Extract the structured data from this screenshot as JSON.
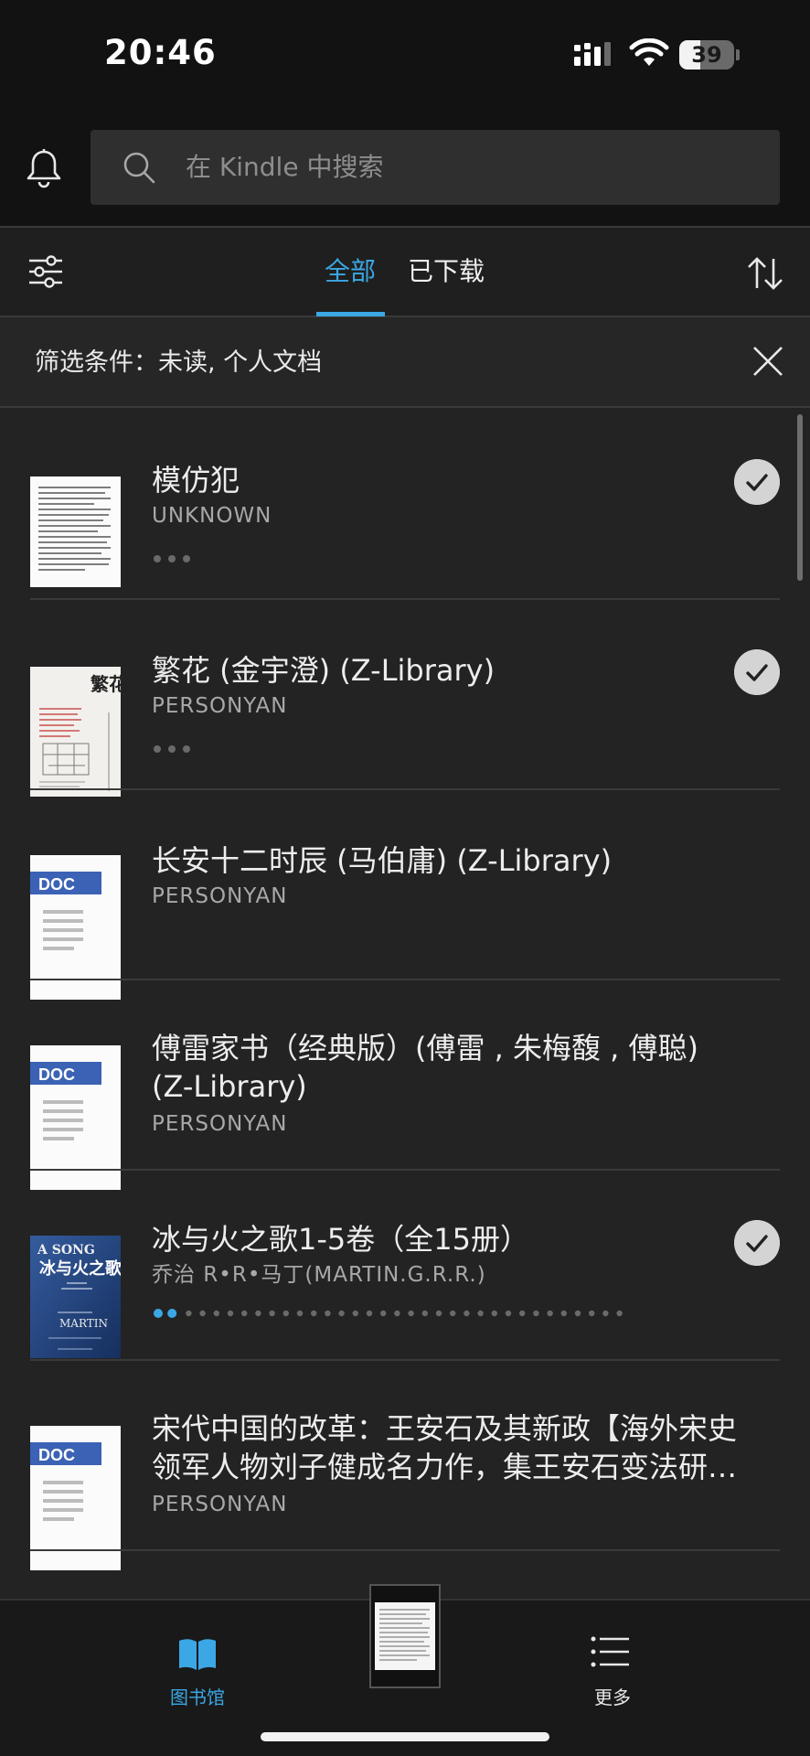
{
  "status_bar": {
    "time": "20:46",
    "battery": "39",
    "battery_level": 0.39
  },
  "header": {
    "search_placeholder": "在 Kindle 中搜索"
  },
  "tabs": {
    "all": "全部",
    "downloaded": "已下载",
    "active": "all"
  },
  "filter": {
    "text": "筛选条件：未读, 个人文档"
  },
  "books": [
    {
      "title": "模仿犯",
      "author": "UNKNOWN",
      "cover": "scan",
      "downloaded": true,
      "progress": "dots"
    },
    {
      "title": "繁花 (金宇澄) (Z-Library)",
      "author": "PERSONYAN",
      "cover": "fanhua",
      "cover_text": "繁花",
      "downloaded": true,
      "progress": "dots"
    },
    {
      "title": "长安十二时辰 (马伯庸) (Z-Library)",
      "author": "PERSONYAN",
      "cover": "doc",
      "cover_text": "DOC",
      "downloaded": false,
      "progress": "none"
    },
    {
      "title": "傅雷家书（经典版）(傅雷 , 朱梅馥 , 傅聪) (Z-Library)",
      "author": "PERSONYAN",
      "cover": "doc",
      "cover_text": "DOC",
      "downloaded": false,
      "progress": "none"
    },
    {
      "title": "冰与火之歌1-5卷（全15册）",
      "author": "乔治 R•R•马丁(MARTIN.G.R.R.)",
      "cover": "asoiaf",
      "cover_text": "冰与火之歌",
      "cover_text_en": "A SONG",
      "cover_author": "MARTIN",
      "downloaded": true,
      "progress": "series",
      "series_total": 34,
      "series_read": 2
    },
    {
      "title": "宋代中国的改革：王安石及其新政【海外宋史领军人物刘子健成名力作，集王安石变法研…",
      "author": "PERSONYAN",
      "cover": "doc",
      "cover_text": "DOC",
      "downloaded": false,
      "progress": "none"
    }
  ],
  "bottom_nav": {
    "library_label": "图书馆",
    "more_label": "更多"
  },
  "colors": {
    "accent": "#3ba7e5",
    "background": "#232323",
    "doc_band": "#3b62b4"
  }
}
